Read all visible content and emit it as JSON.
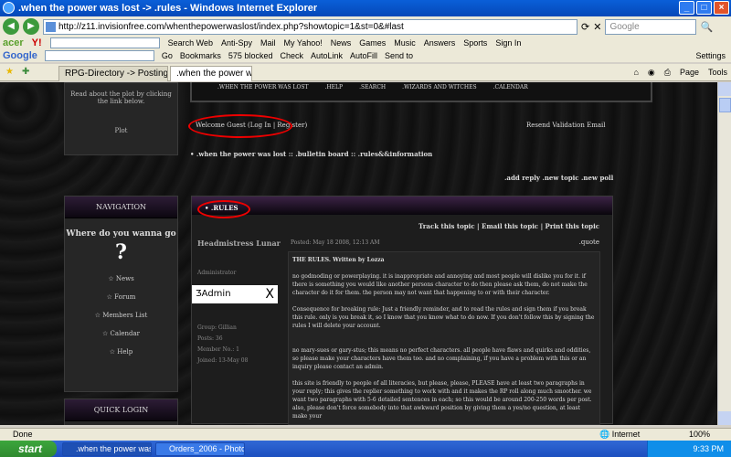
{
  "window": {
    "title": ".when the power was lost -> .rules - Windows Internet Explorer"
  },
  "address": {
    "url": "http://z11.invisionfree.com/whenthepowerwaslost/index.php?showtopic=1&st=0&#last",
    "search_placeholder": "Google"
  },
  "toolbar1": {
    "items": [
      "acer",
      "Y!",
      "Search Web",
      "Anti-Spy",
      "Mail",
      "My Yahoo!",
      "News",
      "Games",
      "Music",
      "Answers",
      "Sports",
      "Sign In"
    ]
  },
  "toolbar2": {
    "items": [
      "Google",
      "Go",
      "Bookmarks",
      "575 blocked",
      "Check",
      "AutoLink",
      "AutoFill",
      "Send to",
      "Settings"
    ]
  },
  "tabs": [
    {
      "label": "RPG-Directory -> Posting Ne..."
    },
    {
      "label": ".when the power was los..."
    }
  ],
  "commands": {
    "page": "Page",
    "tools": "Tools"
  },
  "forum": {
    "nav": [
      ".WHEN THE POWER WAS LOST",
      ".HELP",
      ".SEARCH",
      ".WIZARDS AND WITCHES",
      ".CALENDAR"
    ],
    "plot_box": {
      "text": "Read about the plot by clicking the link below.",
      "link": "Plot"
    },
    "welcome": {
      "prefix": "Welcome Guest (",
      "login": "Log In",
      "sep": " | ",
      "register": "Register",
      "suffix": ")"
    },
    "resend": "Resend Validation Email",
    "breadcrumb": "• .when the power was lost  ::  .bulletin board  ::  .rules&&information",
    "actions": ".add reply .new topic .new poll",
    "navigation": {
      "header": "NAVIGATION",
      "question": "Where do you wanna go",
      "items": [
        "News",
        "Forum",
        "Members List",
        "Calendar",
        "Help"
      ]
    },
    "quick_login": "QUICK LOGIN",
    "topic": {
      "title": ".RULES",
      "links": "Track this topic | Email this topic | Print this topic",
      "author": "Headmistress Lunar",
      "posted": "Posted: May 18 2008, 12:13 AM",
      "quote": ".quote",
      "role": "Administrator",
      "avatar": "ƷAdmin",
      "group": "Group: Gillian",
      "posts": "Posts: 36",
      "member_no": "Member No.: 1",
      "joined": "Joined: 13-May 08",
      "body": [
        "THE RULES. Written by Lozza",
        "no godmoding or powerplaying. it is inappropriate and annoying and most people will dislike you for it. if there is something you would like another persons character to do then please ask them, do not make the character do it for them. the person may not want that happening to or with their character.",
        "Consequence for breaking rule: Just a friendly reminder, and to read the rules and sign them if you break this rule. only is you break it, so I know that you know what to do now. If you don't follow this by signing the rules I will delete your account.",
        "no mary-sues or gary-stus; this means no perfect characters. all people have flaws and quirks and oddities, so please make your characters have them too. and no complaining, if you have a problem with this or an inquiry please contact an admin.",
        "this site is friendly to people of all literacies, but please, please, PLEASE have at least two paragraphs in your reply; this gives the replier something to work with and it makes the RP roll along much smoother. we want two paragraphs with 5-6 detailed sentences in each; so this would be around 200-250 words per post. also, please don't force somebody into that awkward position by giving them a yes/no question, at least make your"
      ]
    }
  },
  "status": {
    "text": "Done",
    "zone": "Internet",
    "zoom": "100%"
  },
  "taskbar": {
    "start": "start",
    "tasks": [
      ".when the power was...",
      "Orders_2006 - Photo..."
    ],
    "clock": "9:33 PM"
  }
}
